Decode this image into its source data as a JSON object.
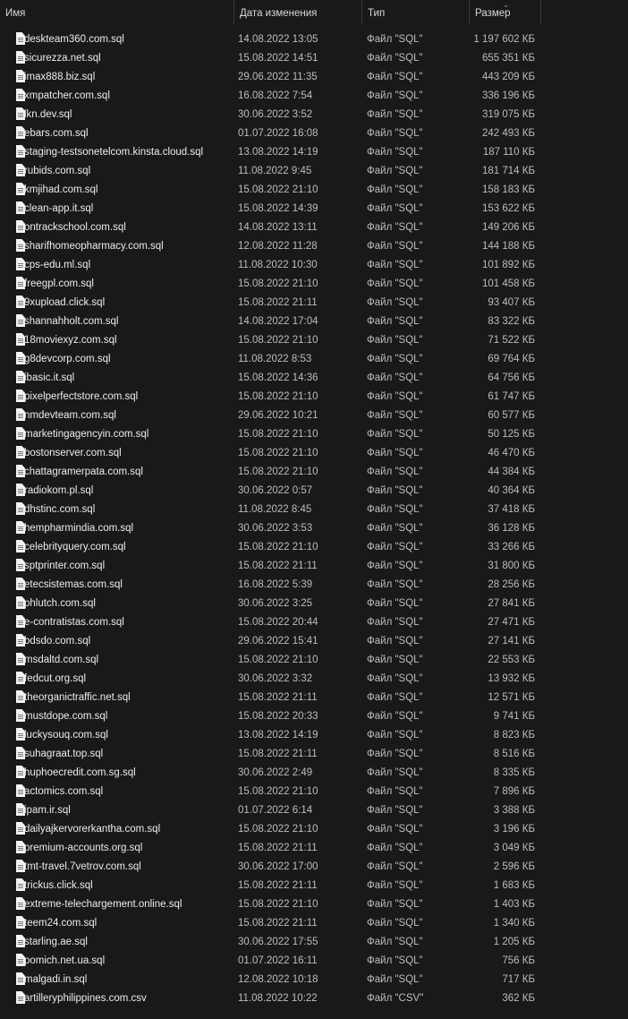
{
  "columns": {
    "name": "Имя",
    "date": "Дата изменения",
    "type": "Тип",
    "size": "Размер"
  },
  "sort_indicator": "⌄",
  "files": [
    {
      "name": "deskteam360.com.sql",
      "date": "14.08.2022 13:05",
      "type": "Файл \"SQL\"",
      "size": "1 197 602 КБ"
    },
    {
      "name": "sicurezza.net.sql",
      "date": "15.08.2022 14:51",
      "type": "Файл \"SQL\"",
      "size": "655 351 КБ"
    },
    {
      "name": "imax888.biz.sql",
      "date": "29.06.2022 11:35",
      "type": "Файл \"SQL\"",
      "size": "443 209 КБ"
    },
    {
      "name": "xmpatcher.com.sql",
      "date": "16.08.2022 7:54",
      "type": "Файл \"SQL\"",
      "size": "336 196 КБ"
    },
    {
      "name": "lkn.dev.sql",
      "date": "30.06.2022 3:52",
      "type": "Файл \"SQL\"",
      "size": "319 075 КБ"
    },
    {
      "name": "ebars.com.sql",
      "date": "01.07.2022 16:08",
      "type": "Файл \"SQL\"",
      "size": "242 493 КБ"
    },
    {
      "name": "staging-testsonetelcom.kinsta.cloud.sql",
      "date": "13.08.2022 14:19",
      "type": "Файл \"SQL\"",
      "size": "187 110 КБ"
    },
    {
      "name": "rubids.com.sql",
      "date": "11.08.2022 9:45",
      "type": "Файл \"SQL\"",
      "size": "181 714 КБ"
    },
    {
      "name": "kmjihad.com.sql",
      "date": "15.08.2022 21:10",
      "type": "Файл \"SQL\"",
      "size": "158 183 КБ"
    },
    {
      "name": "clean-app.it.sql",
      "date": "15.08.2022 14:39",
      "type": "Файл \"SQL\"",
      "size": "153 622 КБ"
    },
    {
      "name": "ontrackschool.com.sql",
      "date": "14.08.2022 13:11",
      "type": "Файл \"SQL\"",
      "size": "149 206 КБ"
    },
    {
      "name": "sharifhomeopharmacy.com.sql",
      "date": "12.08.2022 11:28",
      "type": "Файл \"SQL\"",
      "size": "144 188 КБ"
    },
    {
      "name": "cps-edu.ml.sql",
      "date": "11.08.2022 10:30",
      "type": "Файл \"SQL\"",
      "size": "101 892 КБ"
    },
    {
      "name": "freegpl.com.sql",
      "date": "15.08.2022 21:10",
      "type": "Файл \"SQL\"",
      "size": "101 458 КБ"
    },
    {
      "name": "9xupload.click.sql",
      "date": "15.08.2022 21:11",
      "type": "Файл \"SQL\"",
      "size": "93 407 КБ"
    },
    {
      "name": "shannahholt.com.sql",
      "date": "14.08.2022 17:04",
      "type": "Файл \"SQL\"",
      "size": "83 322 КБ"
    },
    {
      "name": "18moviexyz.com.sql",
      "date": "15.08.2022 21:10",
      "type": "Файл \"SQL\"",
      "size": "71 522 КБ"
    },
    {
      "name": "g8devcorp.com.sql",
      "date": "11.08.2022 8:53",
      "type": "Файл \"SQL\"",
      "size": "69 764 КБ"
    },
    {
      "name": "ibasic.it.sql",
      "date": "15.08.2022 14:36",
      "type": "Файл \"SQL\"",
      "size": "64 756 КБ"
    },
    {
      "name": "pixelperfectstore.com.sql",
      "date": "15.08.2022 21:10",
      "type": "Файл \"SQL\"",
      "size": "61 747 КБ"
    },
    {
      "name": "nmdevteam.com.sql",
      "date": "29.06.2022 10:21",
      "type": "Файл \"SQL\"",
      "size": "60 577 КБ"
    },
    {
      "name": "marketingagencyin.com.sql",
      "date": "15.08.2022 21:10",
      "type": "Файл \"SQL\"",
      "size": "50 125 КБ"
    },
    {
      "name": "bostonserver.com.sql",
      "date": "15.08.2022 21:10",
      "type": "Файл \"SQL\"",
      "size": "46 470 КБ"
    },
    {
      "name": "chattagramerpata.com.sql",
      "date": "15.08.2022 21:10",
      "type": "Файл \"SQL\"",
      "size": "44 384 КБ"
    },
    {
      "name": "radiokom.pl.sql",
      "date": "30.06.2022 0:57",
      "type": "Файл \"SQL\"",
      "size": "40 364 КБ"
    },
    {
      "name": "dhstinc.com.sql",
      "date": "11.08.2022 8:45",
      "type": "Файл \"SQL\"",
      "size": "37 418 КБ"
    },
    {
      "name": "hempharmindia.com.sql",
      "date": "30.06.2022 3:53",
      "type": "Файл \"SQL\"",
      "size": "36 128 КБ"
    },
    {
      "name": "celebrityquery.com.sql",
      "date": "15.08.2022 21:10",
      "type": "Файл \"SQL\"",
      "size": "33 266 КБ"
    },
    {
      "name": "sptprinter.com.sql",
      "date": "15.08.2022 21:11",
      "type": "Файл \"SQL\"",
      "size": "31 800 КБ"
    },
    {
      "name": "etecsistemas.com.sql",
      "date": "16.08.2022 5:39",
      "type": "Файл \"SQL\"",
      "size": "28 256 КБ"
    },
    {
      "name": "phlutch.com.sql",
      "date": "30.06.2022 3:25",
      "type": "Файл \"SQL\"",
      "size": "27 841 КБ"
    },
    {
      "name": "e-contratistas.com.sql",
      "date": "15.08.2022 20:44",
      "type": "Файл \"SQL\"",
      "size": "27 471 КБ"
    },
    {
      "name": "bdsdo.com.sql",
      "date": "29.06.2022 15:41",
      "type": "Файл \"SQL\"",
      "size": "27 141 КБ"
    },
    {
      "name": "msdaltd.com.sql",
      "date": "15.08.2022 21:10",
      "type": "Файл \"SQL\"",
      "size": "22 553 КБ"
    },
    {
      "name": "fedcut.org.sql",
      "date": "30.06.2022 3:32",
      "type": "Файл \"SQL\"",
      "size": "13 932 КБ"
    },
    {
      "name": "theorganictraffic.net.sql",
      "date": "15.08.2022 21:11",
      "type": "Файл \"SQL\"",
      "size": "12 571 КБ"
    },
    {
      "name": "mustdope.com.sql",
      "date": "15.08.2022 20:33",
      "type": "Файл \"SQL\"",
      "size": "9 741 КБ"
    },
    {
      "name": "luckysouq.com.sql",
      "date": "13.08.2022 14:19",
      "type": "Файл \"SQL\"",
      "size": "8 823 КБ"
    },
    {
      "name": "suhagraat.top.sql",
      "date": "15.08.2022 21:11",
      "type": "Файл \"SQL\"",
      "size": "8 516 КБ"
    },
    {
      "name": "huphoecredit.com.sg.sql",
      "date": "30.06.2022 2:49",
      "type": "Файл \"SQL\"",
      "size": "8 335 КБ"
    },
    {
      "name": "actomics.com.sql",
      "date": "15.08.2022 21:10",
      "type": "Файл \"SQL\"",
      "size": "7 896 КБ"
    },
    {
      "name": "ipam.ir.sql",
      "date": "01.07.2022 6:14",
      "type": "Файл \"SQL\"",
      "size": "3 388 КБ"
    },
    {
      "name": "dailyajkervorerkantha.com.sql",
      "date": "15.08.2022 21:10",
      "type": "Файл \"SQL\"",
      "size": "3 196 КБ"
    },
    {
      "name": "premium-accounts.org.sql",
      "date": "15.08.2022 21:11",
      "type": "Файл \"SQL\"",
      "size": "3 049 КБ"
    },
    {
      "name": "tmt-travel.7vetrov.com.sql",
      "date": "30.06.2022 17:00",
      "type": "Файл \"SQL\"",
      "size": "2 596 КБ"
    },
    {
      "name": "trickus.click.sql",
      "date": "15.08.2022 21:11",
      "type": "Файл \"SQL\"",
      "size": "1 683 КБ"
    },
    {
      "name": "extreme-telechargement.online.sql",
      "date": "15.08.2022 21:10",
      "type": "Файл \"SQL\"",
      "size": "1 403 КБ"
    },
    {
      "name": "teem24.com.sql",
      "date": "15.08.2022 21:11",
      "type": "Файл \"SQL\"",
      "size": "1 340 КБ"
    },
    {
      "name": "starling.ae.sql",
      "date": "30.06.2022 17:55",
      "type": "Файл \"SQL\"",
      "size": "1 205 КБ"
    },
    {
      "name": "pomich.net.ua.sql",
      "date": "01.07.2022 16:11",
      "type": "Файл \"SQL\"",
      "size": "756 КБ"
    },
    {
      "name": "malgadi.in.sql",
      "date": "12.08.2022 10:18",
      "type": "Файл \"SQL\"",
      "size": "717 КБ"
    },
    {
      "name": "artilleryphilippines.com.csv",
      "date": "11.08.2022 10:22",
      "type": "Файл \"CSV\"",
      "size": "362 КБ"
    }
  ]
}
